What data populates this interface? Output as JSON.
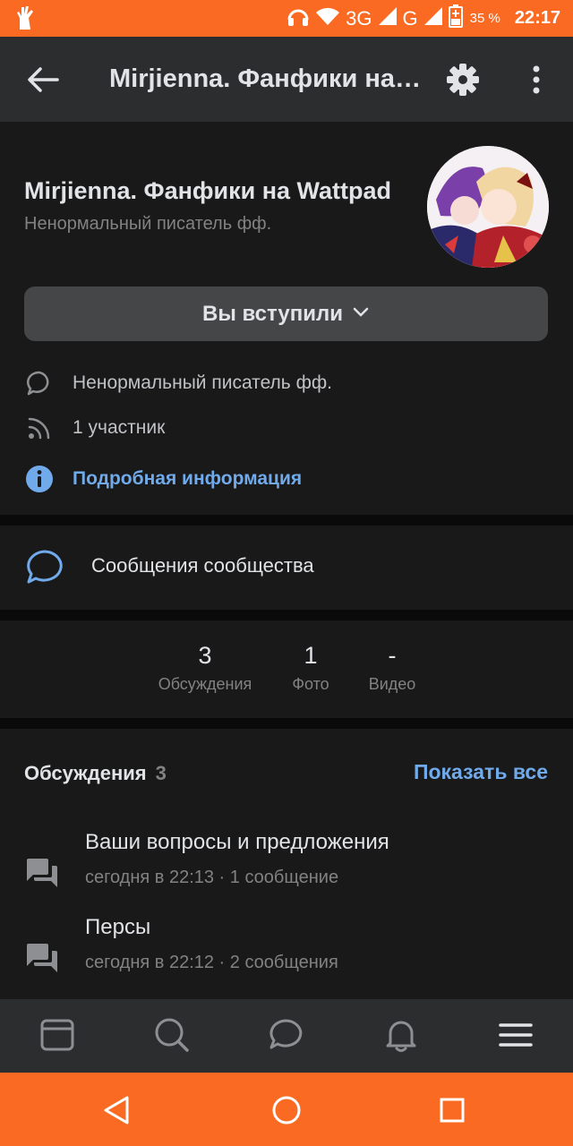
{
  "status_bar": {
    "network_1": "3G",
    "network_2": "G",
    "battery": "35 %",
    "time": "22:17",
    "icons": [
      "hand-notification-icon",
      "headphones-icon",
      "wifi-icon",
      "signal-icon",
      "battery-icon"
    ]
  },
  "app_bar": {
    "title": "Mirjienna. Фанфики на Wattpad",
    "icons": [
      "back-arrow-icon",
      "gear-icon",
      "more-vertical-icon"
    ]
  },
  "group": {
    "name": "Mirjienna. Фанфики на Wattpad",
    "status": "Ненормальный писатель фф.",
    "joined_label": "Вы вступили",
    "info": {
      "description": "Ненормальный писатель фф.",
      "members": "1 участник",
      "more_info": "Подробная информация"
    }
  },
  "messages": {
    "label": "Сообщения сообщества"
  },
  "counters": [
    {
      "value": "3",
      "label": "Обсуждения"
    },
    {
      "value": "1",
      "label": "Фото"
    },
    {
      "value": "-",
      "label": "Видео"
    }
  ],
  "discussions": {
    "title": "Обсуждения",
    "count": "3",
    "show_all": "Показать все",
    "topics": [
      {
        "title": "Ваши вопросы и предложения",
        "meta": "сегодня в 22:13 · 1 сообщение"
      },
      {
        "title": "Персы",
        "meta": "сегодня в 22:12 · 2 сообщения"
      }
    ]
  },
  "tab_bar": [
    "news-icon",
    "search-icon",
    "messages-icon",
    "notifications-icon",
    "menu-icon"
  ],
  "nav_bar": [
    "back-icon",
    "home-icon",
    "recents-icon"
  ],
  "colors": {
    "accent": "#fb6a22",
    "link": "#71aaeb",
    "background": "#19191a",
    "surface": "#2c2d2e"
  }
}
